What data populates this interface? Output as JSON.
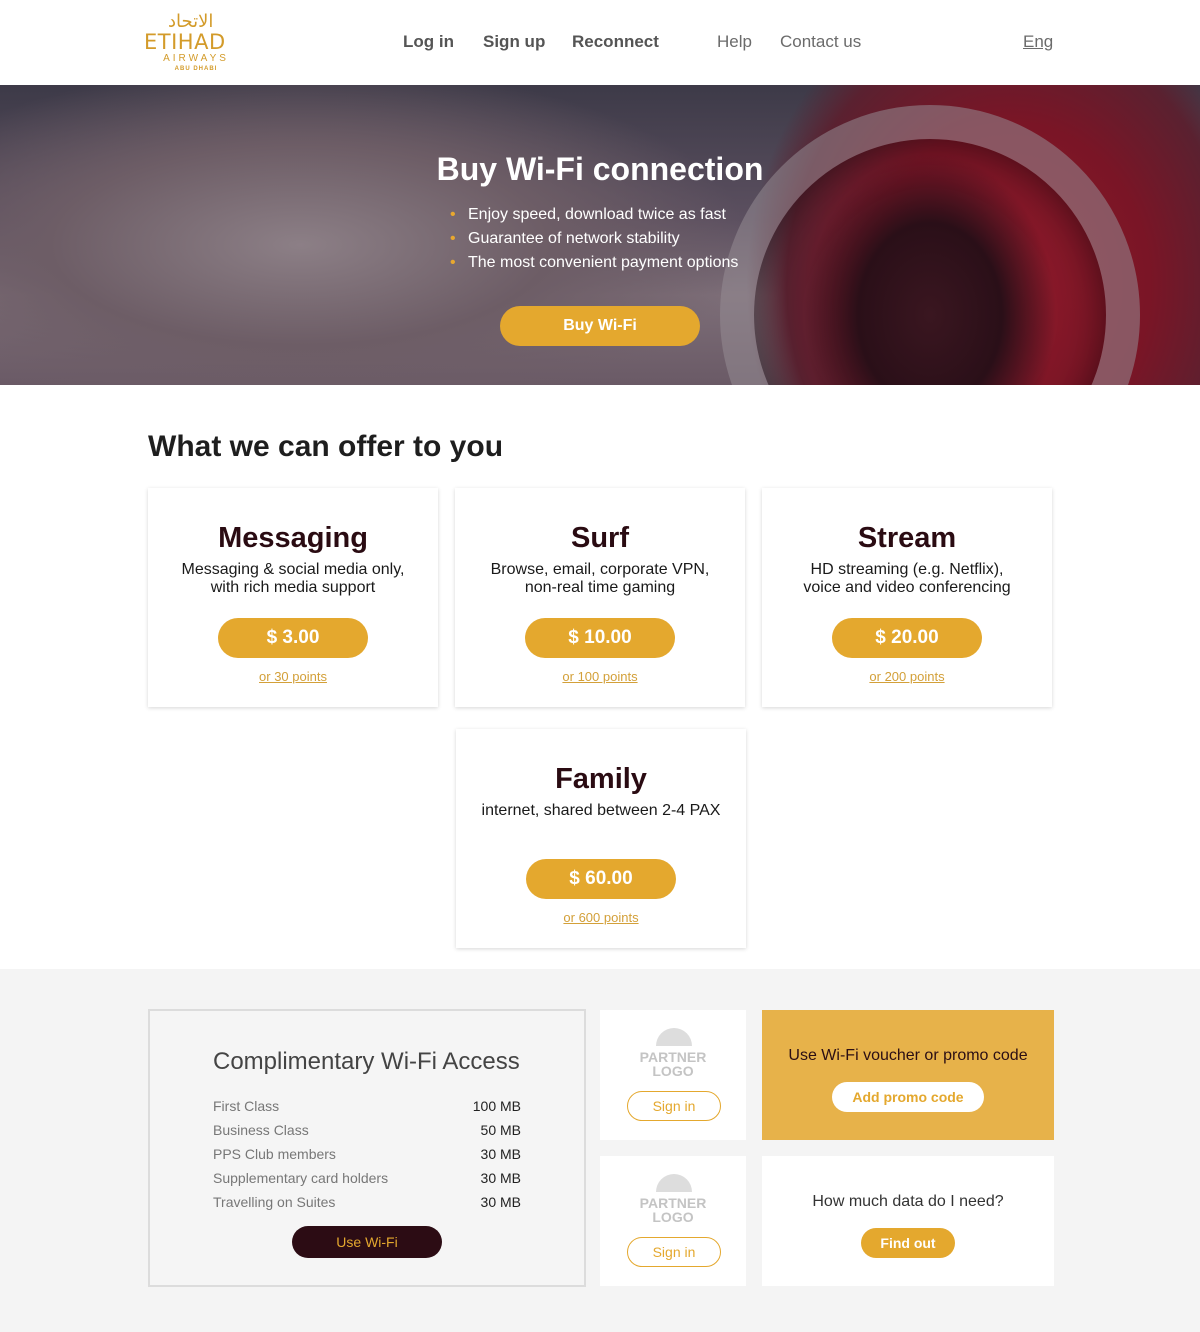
{
  "header": {
    "logo": {
      "arabic": "الاتحاد",
      "brand": "ETIHAD",
      "airways": "AIRWAYS",
      "city": "ABU DHABI"
    },
    "nav_primary": [
      "Log in",
      "Sign up",
      "Reconnect"
    ],
    "nav_secondary": [
      "Help",
      "Contact us"
    ],
    "language": "Eng"
  },
  "hero": {
    "title": "Buy Wi-Fi connection",
    "bullets": [
      "Enjoy speed, download twice as fast",
      "Guarantee of network stability",
      "The most convenient payment options"
    ],
    "button": "Buy Wi-Fi"
  },
  "offers": {
    "title": "What we can offer to you",
    "plans": [
      {
        "name": "Messaging",
        "desc_1": "Messaging & social media only,",
        "desc_2": "with rich media support",
        "price": "$ 3.00",
        "points": "or 30 points"
      },
      {
        "name": "Surf",
        "desc_1": "Browse, email, corporate VPN,",
        "desc_2": "non-real time gaming",
        "price": "$ 10.00",
        "points": "or 100 points"
      },
      {
        "name": "Stream",
        "desc_1": "HD streaming (e.g. Netflix),",
        "desc_2": "voice and video conferencing",
        "price": "$ 20.00",
        "points": "or 200 points"
      },
      {
        "name": "Family",
        "desc_1": "internet, shared between 2-4 PAX",
        "desc_2": "",
        "price": "$ 60.00",
        "points": "or 600 points"
      }
    ]
  },
  "complimentary": {
    "title": "Complimentary Wi-Fi Access",
    "rows": [
      {
        "label": "First Class",
        "value": "100 MB"
      },
      {
        "label": "Business Class",
        "value": "50 MB"
      },
      {
        "label": "PPS Club members",
        "value": "30 MB"
      },
      {
        "label": "Supplementary card holders",
        "value": "30 MB"
      },
      {
        "label": "Travelling on Suites",
        "value": "30 MB"
      }
    ],
    "button": "Use Wi-Fi"
  },
  "partners": [
    {
      "logo_line1": "PARTNER",
      "logo_line2": "LOGO",
      "button": "Sign in"
    },
    {
      "logo_line1": "PARTNER",
      "logo_line2": "LOGO",
      "button": "Sign in"
    }
  ],
  "promo": {
    "title": "Use Wi-Fi voucher or promo code",
    "button": "Add promo code"
  },
  "data_help": {
    "title": "How much data do I need?",
    "button": "Find out"
  },
  "colors": {
    "accent": "#e4a82e",
    "dark": "#2c0c14",
    "promo_bg": "#e7b24a"
  }
}
